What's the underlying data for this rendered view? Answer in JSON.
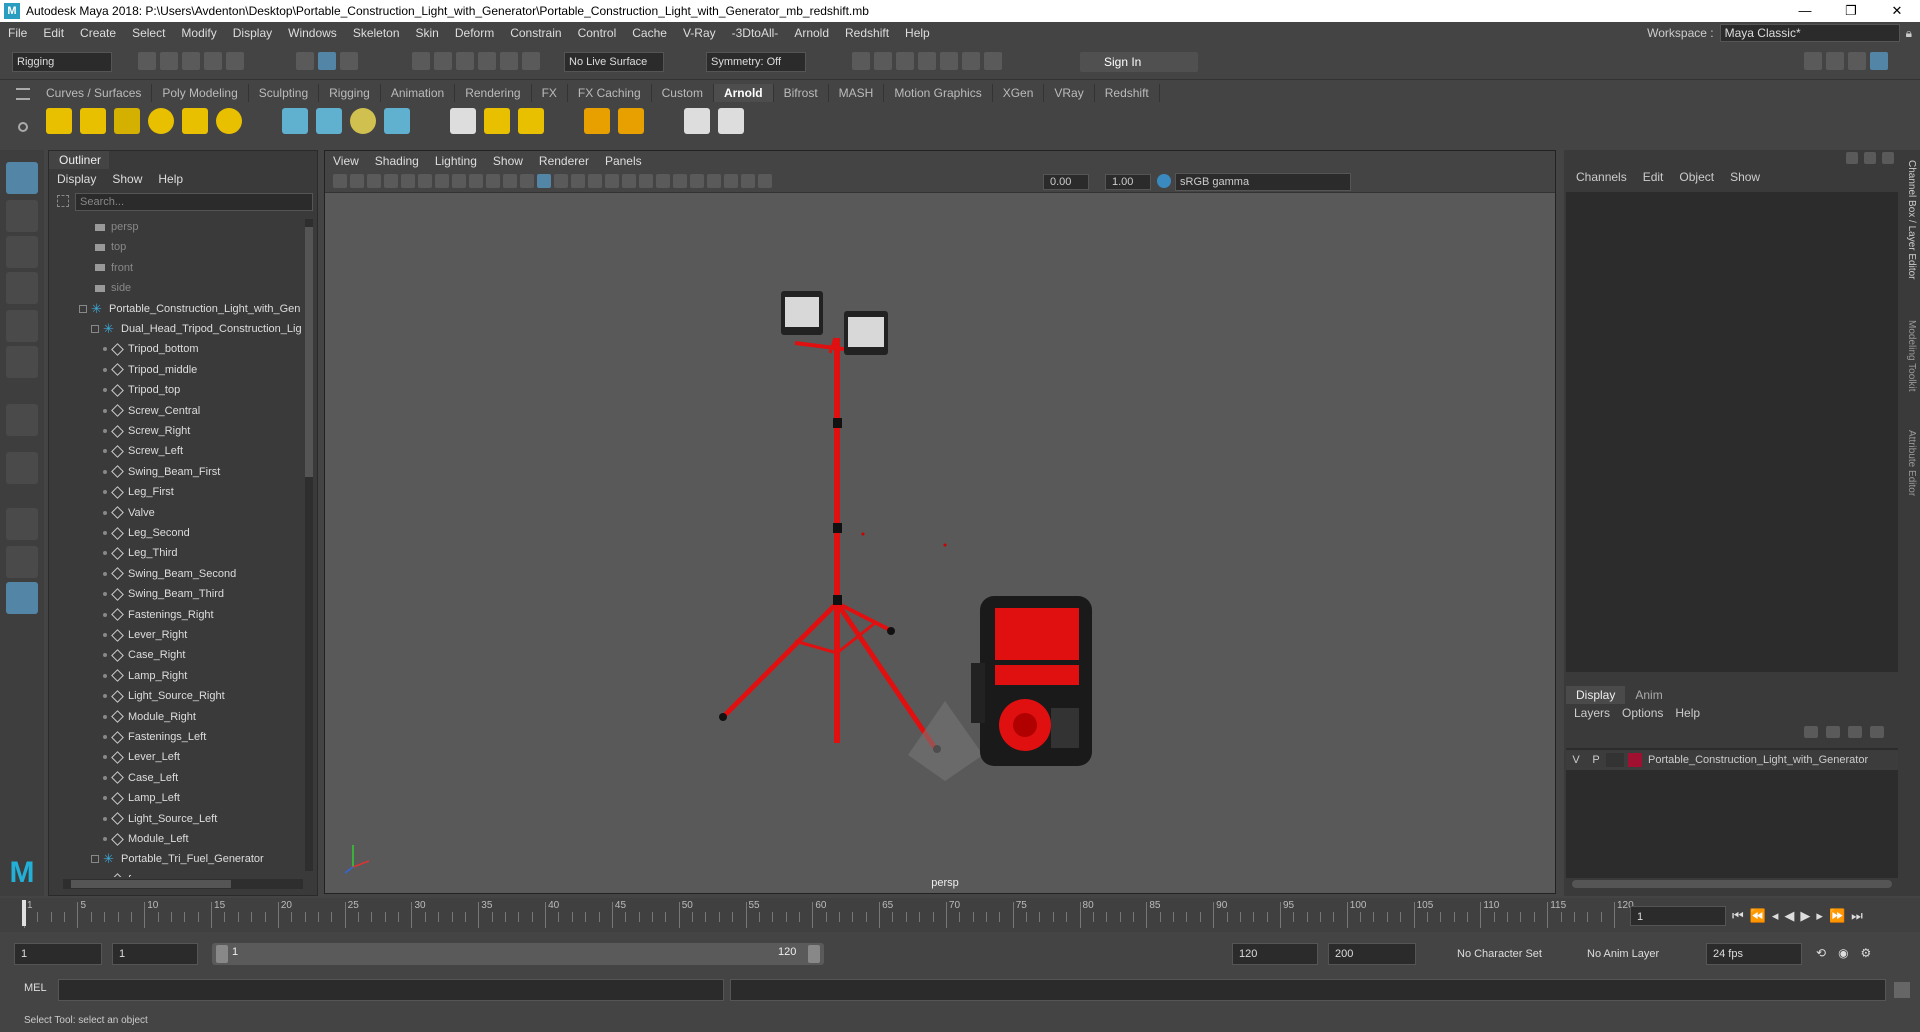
{
  "app": {
    "title": "Autodesk Maya 2018: P:\\Users\\Avdenton\\Desktop\\Portable_Construction_Light_with_Generator\\Portable_Construction_Light_with_Generator_mb_redshift.mb",
    "logo_letter": "M",
    "window_controls": [
      "—",
      "❐",
      "✕"
    ]
  },
  "menubar": {
    "items": [
      "File",
      "Edit",
      "Create",
      "Select",
      "Modify",
      "Display",
      "Windows",
      "Skeleton",
      "Skin",
      "Deform",
      "Constrain",
      "Control",
      "Cache",
      "V-Ray",
      "-3DtoAll-",
      "Arnold",
      "Redshift",
      "Help"
    ],
    "workspace_label": "Workspace :",
    "workspace_value": "Maya Classic*"
  },
  "statusline": {
    "mode": "Rigging",
    "live_surface": "No Live Surface",
    "symmetry": "Symmetry: Off",
    "sign_in": "Sign In"
  },
  "shelf": {
    "tabs": [
      "Curves / Surfaces",
      "Poly Modeling",
      "Sculpting",
      "Rigging",
      "Animation",
      "Rendering",
      "FX",
      "FX Caching",
      "Custom",
      "Arnold",
      "Bifrost",
      "MASH",
      "Motion Graphics",
      "XGen",
      "VRay",
      "Redshift"
    ],
    "active_tab": "Arnold"
  },
  "outliner": {
    "tab": "Outliner",
    "menu": [
      "Display",
      "Show",
      "Help"
    ],
    "search_placeholder": "Search...",
    "items": [
      {
        "label": "persp",
        "type": "camera",
        "depth": 0
      },
      {
        "label": "top",
        "type": "camera",
        "depth": 0
      },
      {
        "label": "front",
        "type": "camera",
        "depth": 0
      },
      {
        "label": "side",
        "type": "camera",
        "depth": 0
      },
      {
        "label": "Portable_Construction_Light_with_Gen",
        "type": "group",
        "depth": 0
      },
      {
        "label": "Dual_Head_Tripod_Construction_Ligl",
        "type": "group",
        "depth": 1
      },
      {
        "label": "Tripod_bottom",
        "type": "mesh",
        "depth": 2
      },
      {
        "label": "Tripod_middle",
        "type": "mesh",
        "depth": 2
      },
      {
        "label": "Tripod_top",
        "type": "mesh",
        "depth": 2
      },
      {
        "label": "Screw_Central",
        "type": "mesh",
        "depth": 2
      },
      {
        "label": "Screw_Right",
        "type": "mesh",
        "depth": 2
      },
      {
        "label": "Screw_Left",
        "type": "mesh",
        "depth": 2
      },
      {
        "label": "Swing_Beam_First",
        "type": "mesh",
        "depth": 2
      },
      {
        "label": "Leg_First",
        "type": "mesh",
        "depth": 2
      },
      {
        "label": "Valve",
        "type": "mesh",
        "depth": 2
      },
      {
        "label": "Leg_Second",
        "type": "mesh",
        "depth": 2
      },
      {
        "label": "Leg_Third",
        "type": "mesh",
        "depth": 2
      },
      {
        "label": "Swing_Beam_Second",
        "type": "mesh",
        "depth": 2
      },
      {
        "label": "Swing_Beam_Third",
        "type": "mesh",
        "depth": 2
      },
      {
        "label": "Fastenings_Right",
        "type": "mesh",
        "depth": 2
      },
      {
        "label": "Lever_Right",
        "type": "mesh",
        "depth": 2
      },
      {
        "label": "Case_Right",
        "type": "mesh",
        "depth": 2
      },
      {
        "label": "Lamp_Right",
        "type": "mesh",
        "depth": 2
      },
      {
        "label": "Light_Source_Right",
        "type": "mesh",
        "depth": 2
      },
      {
        "label": "Module_Right",
        "type": "mesh",
        "depth": 2
      },
      {
        "label": "Fastenings_Left",
        "type": "mesh",
        "depth": 2
      },
      {
        "label": "Lever_Left",
        "type": "mesh",
        "depth": 2
      },
      {
        "label": "Case_Left",
        "type": "mesh",
        "depth": 2
      },
      {
        "label": "Lamp_Left",
        "type": "mesh",
        "depth": 2
      },
      {
        "label": "Light_Source_Left",
        "type": "mesh",
        "depth": 2
      },
      {
        "label": "Module_Left",
        "type": "mesh",
        "depth": 2
      },
      {
        "label": "Portable_Tri_Fuel_Generator",
        "type": "group",
        "depth": 1
      },
      {
        "label": "frame",
        "type": "mesh",
        "depth": 2
      }
    ]
  },
  "viewport": {
    "menu": [
      "View",
      "Shading",
      "Lighting",
      "Show",
      "Renderer",
      "Panels"
    ],
    "near_value": "0.00",
    "far_value": "1.00",
    "color_space": "sRGB gamma",
    "camera_label": "persp"
  },
  "channelbox": {
    "menu": [
      "Channels",
      "Edit",
      "Object",
      "Show"
    ],
    "layer_tabs": [
      "Display",
      "Anim"
    ],
    "layer_menu": [
      "Layers",
      "Options",
      "Help"
    ],
    "layer": {
      "v": "V",
      "p": "P",
      "name": "Portable_Construction_Light_with_Generator",
      "color": "#a01030"
    },
    "side_tabs": [
      "Channel Box / Layer Editor",
      "Modeling Toolkit",
      "Attribute Editor"
    ]
  },
  "timeline": {
    "ticks": [
      "1",
      "5",
      "10",
      "15",
      "20",
      "25",
      "30",
      "35",
      "40",
      "45",
      "50",
      "55",
      "60",
      "65",
      "70",
      "75",
      "80",
      "85",
      "90",
      "95",
      "100",
      "105",
      "110",
      "115",
      "120"
    ],
    "current_frame": "1"
  },
  "range": {
    "start": "1",
    "playback_start": "1",
    "slider_start": "1",
    "slider_end": "120",
    "playback_end": "120",
    "end": "200",
    "character_set": "No Character Set",
    "anim_layer": "No Anim Layer",
    "fps": "24 fps"
  },
  "cmdline": {
    "label": "MEL"
  },
  "helpline": {
    "text": "Select Tool: select an object"
  },
  "colors": {
    "accent": "#5285a6",
    "red": "#e01010"
  }
}
